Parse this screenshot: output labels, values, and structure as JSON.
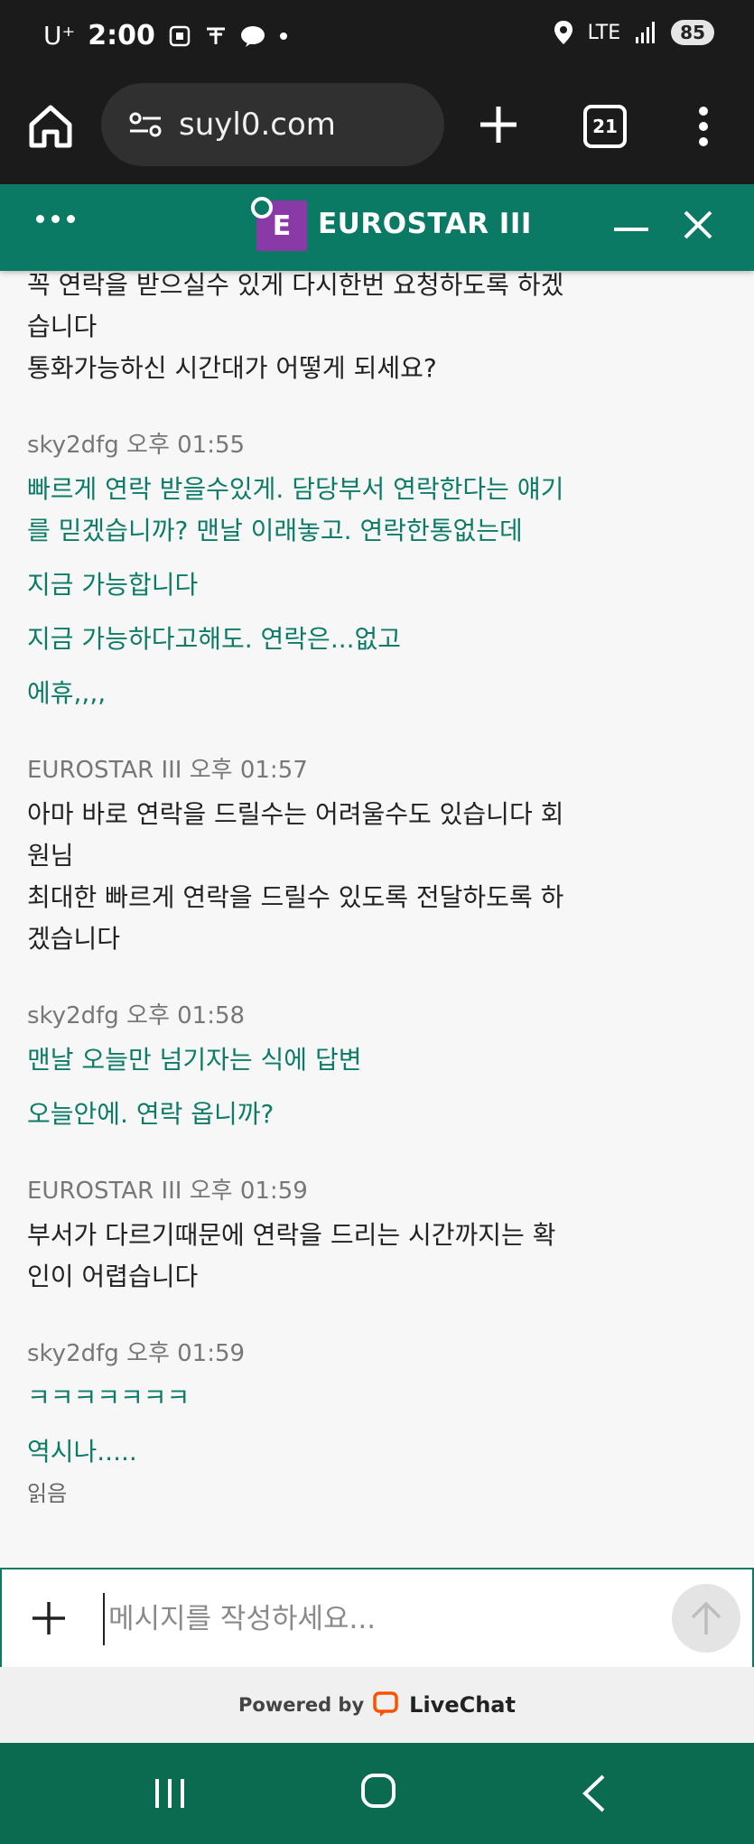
{
  "status_bar": {
    "carrier": "U⁺",
    "time": "2:00",
    "network": "LTE",
    "battery": "85"
  },
  "browser": {
    "url": "suyl0.com",
    "tab_count": "21"
  },
  "chat_header": {
    "avatar_letter": "E",
    "title": "EUROSTAR III"
  },
  "messages": [
    {
      "type": "line",
      "role": "agent",
      "text": "꼭 연락을 받으실수 있게 다시한번 요청하도록 하겠"
    },
    {
      "type": "line",
      "role": "agent",
      "text": "습니다"
    },
    {
      "type": "line",
      "role": "agent",
      "text": "통화가능하신 시간대가 어떻게 되세요?"
    },
    {
      "type": "meta",
      "text": "sky2dfg 오후 01:55"
    },
    {
      "type": "line",
      "role": "user",
      "text": "빠르게 연락 받을수있게. 담당부서 연락한다는 얘기"
    },
    {
      "type": "line",
      "role": "user",
      "text": "를 믿겠습니까? 맨날 이래놓고. 연락한통없는데"
    },
    {
      "type": "line",
      "role": "user",
      "text": "지금 가능합니다"
    },
    {
      "type": "line",
      "role": "user",
      "text": "지금 가능하다고해도. 연락은...없고"
    },
    {
      "type": "line",
      "role": "user",
      "text": "에휴,,,,"
    },
    {
      "type": "meta",
      "text": "EUROSTAR III 오후 01:57"
    },
    {
      "type": "line",
      "role": "agent",
      "text": "아마 바로 연락을 드릴수는 어려울수도 있습니다 회"
    },
    {
      "type": "line",
      "role": "agent",
      "text": "원님"
    },
    {
      "type": "line",
      "role": "agent",
      "text": "최대한 빠르게 연락을 드릴수 있도록 전달하도록 하"
    },
    {
      "type": "line",
      "role": "agent",
      "text": "겠습니다"
    },
    {
      "type": "meta",
      "text": "sky2dfg 오후 01:58"
    },
    {
      "type": "line",
      "role": "user",
      "text": "맨날 오늘만 넘기자는 식에 답변"
    },
    {
      "type": "line",
      "role": "user",
      "text": "오늘안에. 연락 옵니까?"
    },
    {
      "type": "meta",
      "text": "EUROSTAR III 오후 01:59"
    },
    {
      "type": "line",
      "role": "agent",
      "text": "부서가 다르기때문에 연락을 드리는 시간까지는 확"
    },
    {
      "type": "line",
      "role": "agent",
      "text": "인이 어렵습니다"
    },
    {
      "type": "meta",
      "text": "sky2dfg 오후 01:59"
    },
    {
      "type": "line",
      "role": "user",
      "text": "ㅋㅋㅋㅋㅋㅋㅋ"
    },
    {
      "type": "line",
      "role": "user",
      "text": "역시나....."
    },
    {
      "type": "read",
      "text": "읽음"
    }
  ],
  "composer": {
    "placeholder": "메시지를 작성하세요..."
  },
  "footer": {
    "powered_by": "Powered by",
    "brand": "LiveChat"
  },
  "colors": {
    "brand_green": "#0a7a64",
    "user_text": "#0c7b67",
    "avatar_purple": "#8a3aa6",
    "nav_green": "#0b6b50"
  }
}
